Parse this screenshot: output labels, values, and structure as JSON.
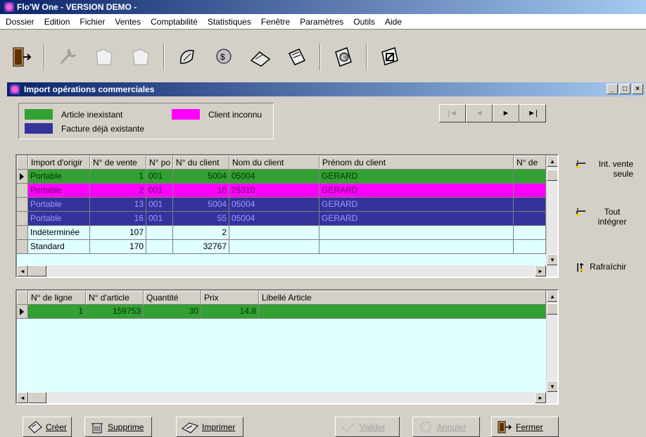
{
  "app": {
    "title": "Flo'W One - VERSION DEMO -"
  },
  "menu": [
    "Dossier",
    "Edition",
    "Fichier",
    "Ventes",
    "Comptabilité",
    "Statistiques",
    "Fenêtre",
    "Paramètres",
    "Outils",
    "Aide"
  ],
  "toolbar": {
    "icons": [
      "exit-door-icon",
      "wrench-icon",
      "folder-icon",
      "folder-icon",
      "sales-icon",
      "accounting-icon",
      "statistics-icon",
      "documents-icon",
      "currency-icon",
      "settings-icon"
    ]
  },
  "child": {
    "title": "Import opérations commerciales"
  },
  "legend": {
    "article_inexistant": "Article inexistant",
    "facture_existante": "Facture déjà existante",
    "client_inconnu": "Client inconnu",
    "colors": {
      "green": "#33a033",
      "blue": "#333399",
      "magenta": "#ff00ff"
    }
  },
  "nav": {
    "first": "|◄",
    "prev": "◄",
    "next": "►",
    "last": "►|"
  },
  "grid1": {
    "headers": [
      "Import d'origir",
      "N° de vente",
      "N° po",
      "N° du client",
      "Nom du client",
      "Prénom du client",
      "N° de"
    ],
    "rows": [
      {
        "import": "Portable",
        "vente": "1",
        "po": "001",
        "client": "5004",
        "nom": "05004",
        "prenom": "GERARD",
        "color": "green"
      },
      {
        "import": "Portable",
        "vente": "2",
        "po": "001",
        "client": "10",
        "nom": "25310",
        "prenom": "GERARD",
        "color": "magenta"
      },
      {
        "import": "Portable",
        "vente": "13",
        "po": "001",
        "client": "5004",
        "nom": "05004",
        "prenom": "GERARD",
        "color": "blue"
      },
      {
        "import": "Portable",
        "vente": "16",
        "po": "001",
        "client": "55",
        "nom": "05004",
        "prenom": "GERARD",
        "color": "blue"
      },
      {
        "import": "Indéterminée",
        "vente": "107",
        "po": "",
        "client": "2",
        "nom": "",
        "prenom": "",
        "color": "none"
      },
      {
        "import": "Standard",
        "vente": "170",
        "po": "",
        "client": "32767",
        "nom": "",
        "prenom": "",
        "color": "none"
      }
    ]
  },
  "grid2": {
    "headers": [
      "N° de ligne",
      "N° d'article",
      "Quantité",
      "Prix",
      "Libellé Article"
    ],
    "rows": [
      {
        "ligne": "1",
        "article": "159753",
        "quantite": "30",
        "prix": "14.8",
        "libelle": "",
        "color": "green"
      }
    ]
  },
  "right_actions": {
    "int_vente": "Int. vente seule",
    "tout_integrer": "Tout intégrer",
    "rafraichir": "Rafraîchir"
  },
  "bottom": {
    "creer": "Créer",
    "supprimer": "Supprime",
    "imprimer": "Imprimer",
    "valider": "Valider",
    "annuler": "Annuler",
    "fermer": "Fermer"
  }
}
